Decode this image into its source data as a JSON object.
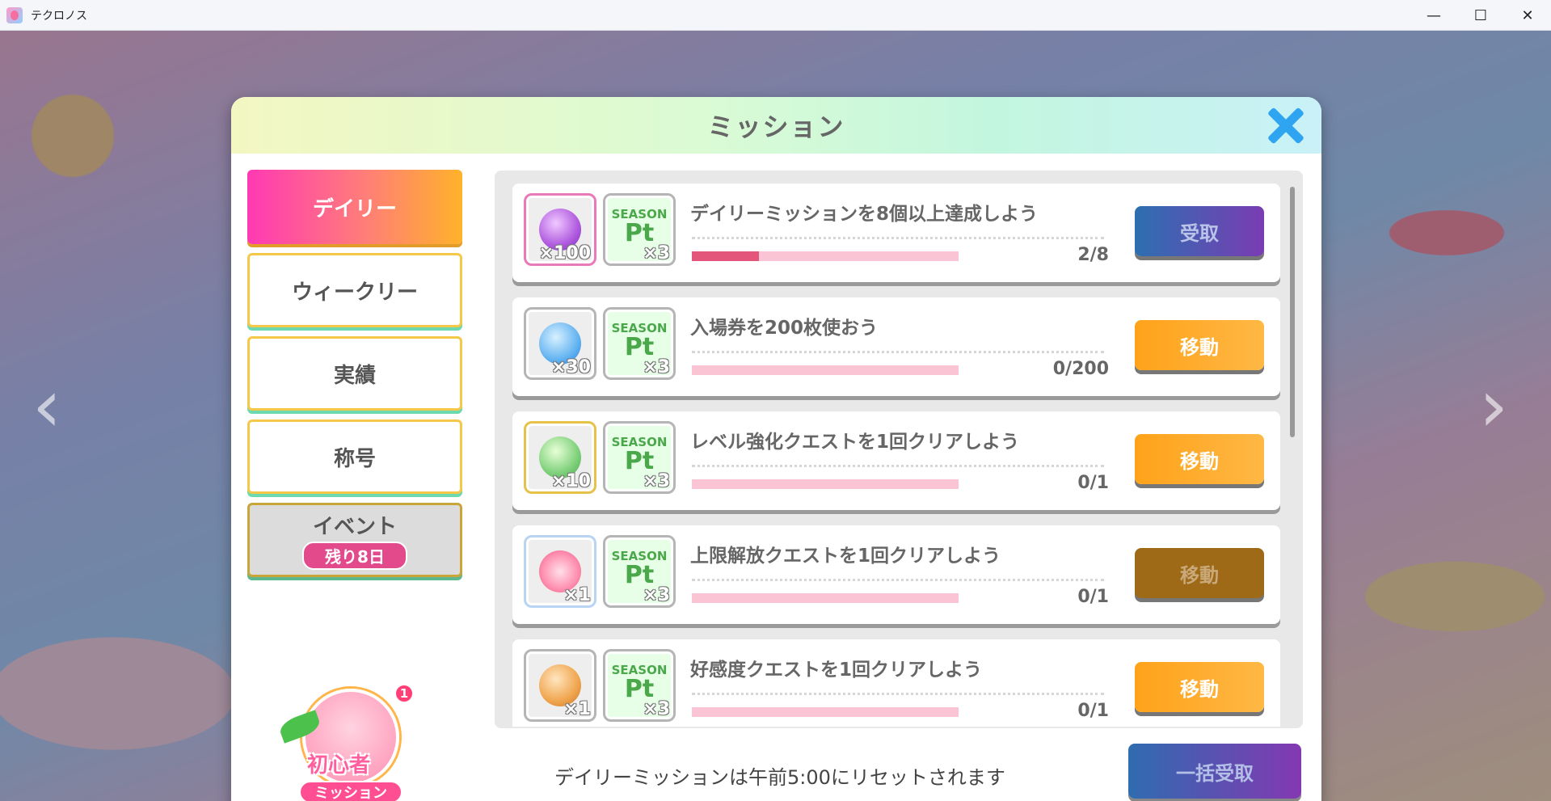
{
  "window": {
    "title": "テクロノス",
    "minimize": "—",
    "maximize": "☐",
    "close": "✕"
  },
  "modal": {
    "title": "ミッション"
  },
  "tabs": [
    {
      "label": "デイリー"
    },
    {
      "label": "ウィークリー"
    },
    {
      "label": "実績"
    },
    {
      "label": "称号"
    },
    {
      "label": "イベント",
      "badge": "残り8日"
    }
  ],
  "beginner_badge": {
    "line1": "初心者",
    "line2": "ミッション",
    "notification_count": "1"
  },
  "missions": [
    {
      "title": "デイリーミッションを8個以上達成しよう",
      "reward1": {
        "icon": "purple-gem-icon",
        "qty": "×100"
      },
      "reward2": {
        "icon": "season-pt-icon",
        "label_top": "SEASON",
        "label_main": "Pt",
        "qty": "×3"
      },
      "progress_text": "2/8",
      "progress": 0.25,
      "button": "受取",
      "button_state": "claim"
    },
    {
      "title": "入場券を200枚使おう",
      "reward1": {
        "icon": "blue-ticket-icon",
        "qty": "×30"
      },
      "reward2": {
        "icon": "season-pt-icon",
        "label_top": "SEASON",
        "label_main": "Pt",
        "qty": "×3"
      },
      "progress_text": "0/200",
      "progress": 0,
      "button": "移動",
      "button_state": "move"
    },
    {
      "title": "レベル強化クエストを1回クリアしよう",
      "reward1": {
        "icon": "green-yarn-icon",
        "qty": "×10"
      },
      "reward2": {
        "icon": "season-pt-icon",
        "label_top": "SEASON",
        "label_main": "Pt",
        "qty": "×3"
      },
      "progress_text": "0/1",
      "progress": 0,
      "button": "移動",
      "button_state": "move"
    },
    {
      "title": "上限解放クエストを1回クリアしよう",
      "reward1": {
        "icon": "ribbon-icon",
        "qty": "×1"
      },
      "reward2": {
        "icon": "season-pt-icon",
        "label_top": "SEASON",
        "label_main": "Pt",
        "qty": "×3"
      },
      "progress_text": "0/1",
      "progress": 0,
      "button": "移動",
      "button_state": "move-dim"
    },
    {
      "title": "好感度クエストを1回クリアしよう",
      "reward1": {
        "icon": "food-basket-icon",
        "qty": "×1"
      },
      "reward2": {
        "icon": "season-pt-icon",
        "label_top": "SEASON",
        "label_main": "Pt",
        "qty": "×3"
      },
      "progress_text": "0/1",
      "progress": 0,
      "button": "移動",
      "button_state": "move"
    }
  ],
  "footer": {
    "reset_note": "デイリーミッションは午前5:00にリセットされます",
    "claim_all": "一括受取"
  },
  "colors": {
    "accent_pink": "#ff39b4",
    "accent_orange": "#ffa21a",
    "close_blue": "#2fa4f0",
    "claim_gradient_start": "#2d6fb0",
    "claim_gradient_end": "#7a3cb3"
  }
}
